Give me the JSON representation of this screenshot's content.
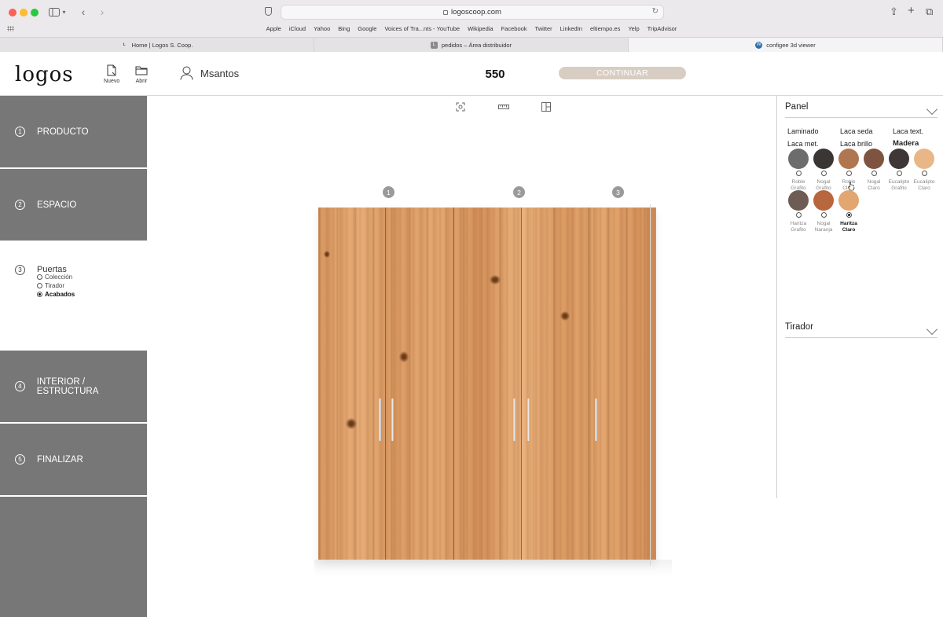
{
  "browser": {
    "url": "logoscoop.com",
    "bookmarks": [
      "Apple",
      "iCloud",
      "Yahoo",
      "Bing",
      "Google",
      "Voices of Tra...nts - YouTube",
      "Wikipedia",
      "Facebook",
      "Twitter",
      "LinkedIn",
      "eltiempo.es",
      "Yelp",
      "TripAdvisor"
    ],
    "tabs": [
      {
        "title": "Home | Logos S. Coop.",
        "icon": "logos-favicon"
      },
      {
        "title": "pedidos – Área distribuidor",
        "icon": "L-favicon"
      },
      {
        "title": "configee 3d viewer",
        "icon": "wordpress-favicon"
      }
    ]
  },
  "header": {
    "logo": "logos",
    "new_label": "Nuevo",
    "open_label": "Abrir",
    "username": "Msantos",
    "price": "550",
    "continue_label": "CONTINUAR"
  },
  "steps": [
    {
      "num": "1",
      "label": "PRODUCTO"
    },
    {
      "num": "2",
      "label": "ESPACIO"
    },
    {
      "num": "3",
      "label": "Puertas",
      "subitems": [
        {
          "label": "Colección",
          "selected": false
        },
        {
          "label": "Tirador",
          "selected": false
        },
        {
          "label": "Acabados",
          "selected": true
        }
      ]
    },
    {
      "num": "4",
      "label": "INTERIOR / ESTRUCTURA"
    },
    {
      "num": "5",
      "label": "FINALIZAR"
    }
  ],
  "viewer": {
    "tools": [
      "camera-focus-icon",
      "ruler-icon",
      "panels-icon"
    ],
    "door_numbers": [
      "1",
      "2",
      "3"
    ]
  },
  "panel": {
    "title": "Panel",
    "types": [
      "Laminado",
      "Laca seda",
      "Laca text.",
      "Laca met.",
      "Laca brillo",
      "Madera"
    ],
    "selected_type": "Madera",
    "swatches": [
      {
        "name1": "Roble",
        "name2": "Grafito",
        "color": "#6c6c6c"
      },
      {
        "name1": "Nogal",
        "name2": "Grafito",
        "color": "#3b3636"
      },
      {
        "name1": "Roble",
        "name2": "Claro",
        "color": "#b07650"
      },
      {
        "name1": "Nogal",
        "name2": "Claro",
        "color": "#7e5440"
      },
      {
        "name1": "Eucalipto",
        "name2": "Grafito",
        "color": "#3f3737"
      },
      {
        "name1": "Eucalipto",
        "name2": "Claro",
        "color": "#e9b787"
      },
      {
        "name1": "Haritza",
        "name2": "Grafito",
        "color": "#6e5c54"
      },
      {
        "name1": "Nogal",
        "name2": "Naranja",
        "color": "#b8663e"
      },
      {
        "name1": "Haritza",
        "name2": "Claro",
        "color": "#e2a670",
        "selected": true
      }
    ]
  },
  "tirador": {
    "title": "Tirador"
  }
}
